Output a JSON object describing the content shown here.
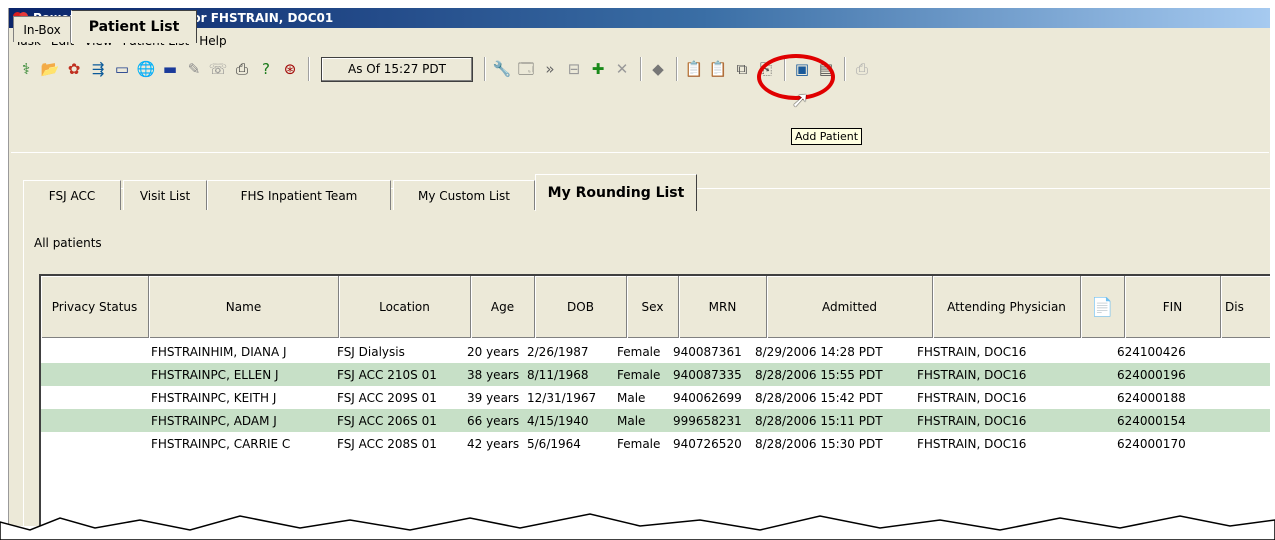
{
  "window": {
    "title": "PowerChart Organizer for FHSTRAIN, DOC01"
  },
  "menu": [
    "Task",
    "Edit",
    "View",
    "Patient List",
    "Help"
  ],
  "toolbar": {
    "left_icons": [
      "patient-search-icon",
      "open-folder-icon",
      "refresh-icon",
      "tracking-icon",
      "calendar-icon",
      "globe-icon",
      "message-icon",
      "dictation-icon",
      "phone-icon",
      "print-icon",
      "help-icon",
      "clock-icon"
    ],
    "as_of": "As Of 15:27 PDT",
    "right_icons": [
      "properties-icon",
      "list-properties-icon",
      "forward-icon",
      "remove-list-icon",
      "add-patient-icon",
      "remove-patient-icon",
      "navigate-icon",
      "clipboard-icon",
      "clipboard-check-icon",
      "copy-icon",
      "paste-icon",
      "print-preview-icon",
      "export-icon",
      "print-icon"
    ],
    "tooltip": "Add Patient"
  },
  "outer_tabs": [
    "In-Box",
    "Patient List"
  ],
  "inner_tabs": [
    "FSJ ACC",
    "Visit List",
    "FHS Inpatient Team",
    "My Custom List",
    "My Rounding List"
  ],
  "filter_label": "All patients",
  "table": {
    "columns": [
      "Privacy Status",
      "Name",
      "Location",
      "Age",
      "DOB",
      "Sex",
      "MRN",
      "Admitted",
      "Attending Physician",
      "",
      "FIN",
      "Dis"
    ],
    "rows": [
      [
        "",
        "FHSTRAINHIM, DIANA J",
        "FSJ Dialysis",
        "20 years",
        "2/26/1987",
        "Female",
        "940087361",
        "8/29/2006 14:28 PDT",
        "FHSTRAIN, DOC16",
        "",
        "624100426"
      ],
      [
        "",
        "FHSTRAINPC, ELLEN J",
        "FSJ ACC 210S 01",
        "38 years",
        "8/11/1968",
        "Female",
        "940087335",
        "8/28/2006 15:55 PDT",
        "FHSTRAIN, DOC16",
        "",
        "624000196"
      ],
      [
        "",
        "FHSTRAINPC, KEITH J",
        "FSJ ACC 209S 01",
        "39 years",
        "12/31/1967",
        "Male",
        "940062699",
        "8/28/2006 15:42 PDT",
        "FHSTRAIN, DOC16",
        "",
        "624000188"
      ],
      [
        "",
        "FHSTRAINPC, ADAM J",
        "FSJ ACC 206S 01",
        "66 years",
        "4/15/1940",
        "Male",
        "999658231",
        "8/28/2006 15:11 PDT",
        "FHSTRAIN, DOC16",
        "",
        "624000154"
      ],
      [
        "",
        "FHSTRAINPC, CARRIE C",
        "FSJ ACC 208S 01",
        "42 years",
        "5/6/1964",
        "Female",
        "940726520",
        "8/28/2006 15:30 PDT",
        "FHSTRAIN, DOC16",
        "",
        "624000170"
      ]
    ]
  },
  "colors": {
    "row_alt": "#c7e0c7",
    "highlight_circle": "#e00000",
    "titlebar": "#0a246a"
  }
}
